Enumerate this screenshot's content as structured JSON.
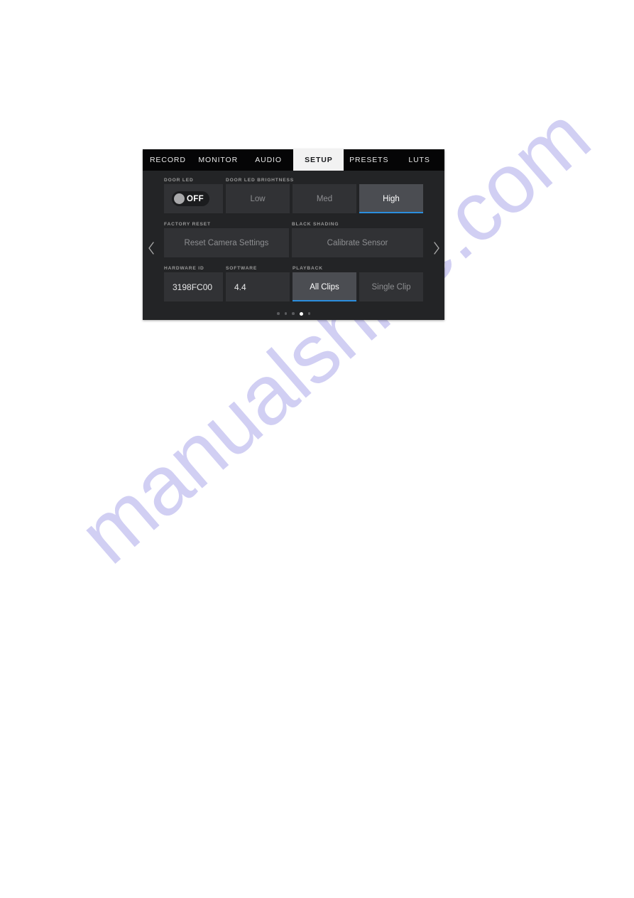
{
  "watermark": {
    "text": "manualshive.com"
  },
  "tabs": [
    {
      "label": "RECORD",
      "active": false
    },
    {
      "label": "MONITOR",
      "active": false
    },
    {
      "label": "AUDIO",
      "active": false
    },
    {
      "label": "SETUP",
      "active": true
    },
    {
      "label": "PRESETS",
      "active": false
    },
    {
      "label": "LUTS",
      "active": false
    }
  ],
  "nav": {
    "prev_icon": "chevron-left-icon",
    "next_icon": "chevron-right-icon"
  },
  "groups": {
    "door_led": {
      "label": "DOOR LED",
      "toggle": {
        "state": "OFF",
        "on": false
      }
    },
    "door_led_brightness": {
      "label": "DOOR LED BRIGHTNESS",
      "options": [
        "Low",
        "Med",
        "High"
      ],
      "selected": "High"
    },
    "factory_reset": {
      "label": "FACTORY RESET",
      "action": "Reset Camera Settings"
    },
    "black_shading": {
      "label": "BLACK SHADING",
      "action": "Calibrate Sensor"
    },
    "hardware_id": {
      "label": "HARDWARE ID",
      "value": "3198FC00"
    },
    "software": {
      "label": "SOFTWARE",
      "value": "4.4"
    },
    "playback": {
      "label": "PLAYBACK",
      "options": [
        "All Clips",
        "Single Clip"
      ],
      "selected": "All Clips"
    }
  },
  "pager": {
    "count": 5,
    "active_index": 3
  },
  "colors": {
    "accent": "#2b8ede",
    "panel_bg": "#232426",
    "tab_bar_bg": "#050506",
    "tab_active_bg": "#f2f2f2",
    "cell_bg": "#313235",
    "cell_selected_bg": "#4b4d52",
    "label_text": "#9a9a9a",
    "watermark": "#cfcdf3"
  }
}
